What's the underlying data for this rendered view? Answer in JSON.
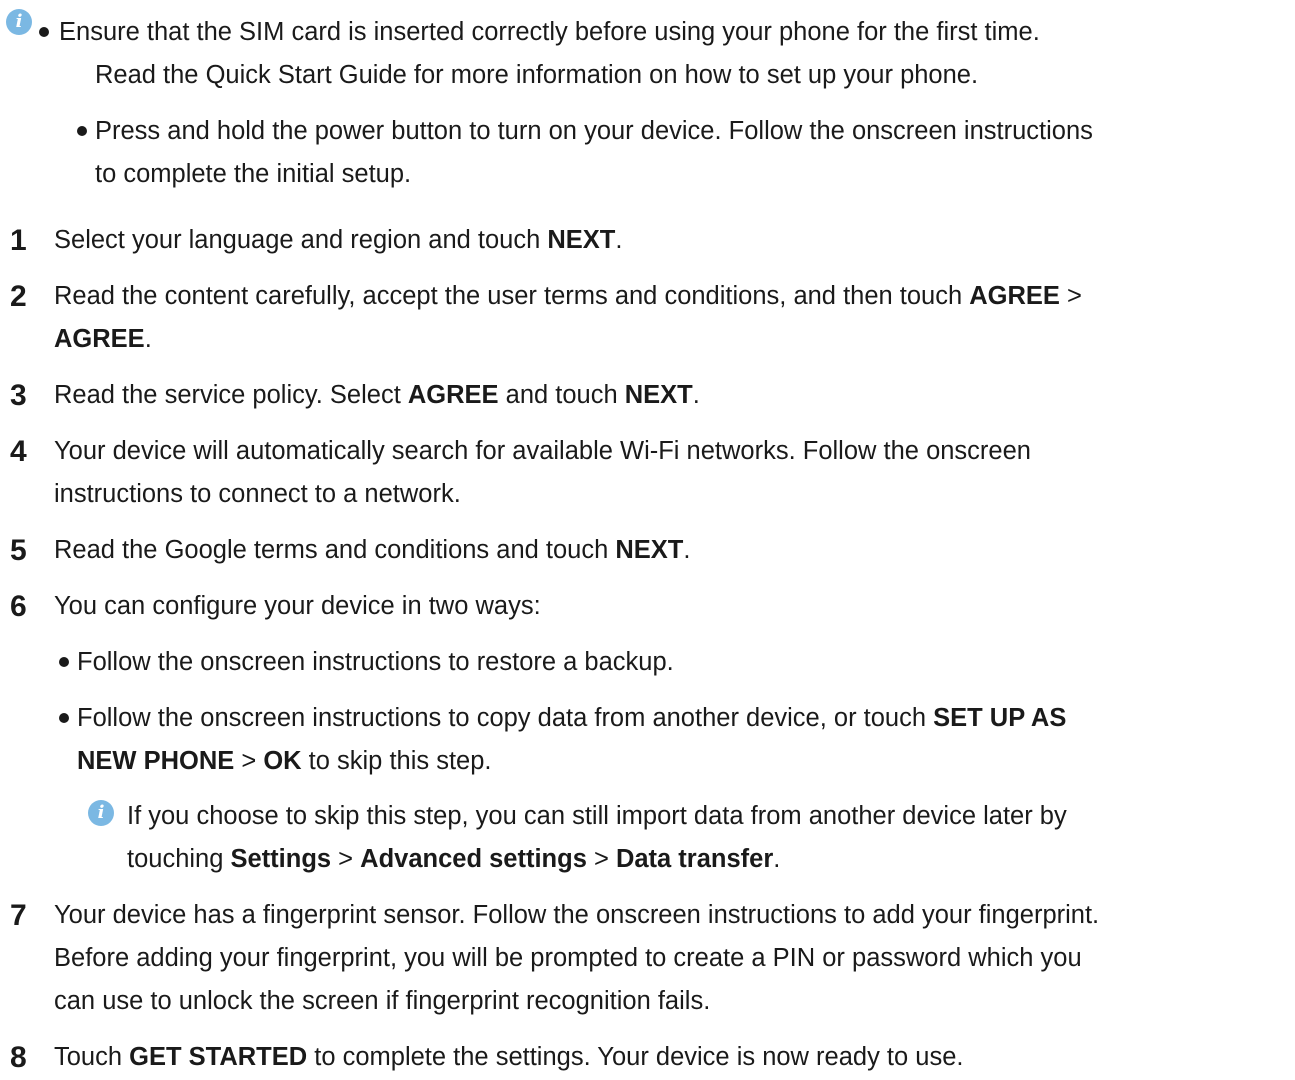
{
  "top_notes": {
    "icon": "info-icon",
    "bullet1": {
      "line1": "Ensure that the SIM card is inserted correctly before using your phone for the first time.",
      "line2": "Read the Quick Start Guide for more information on how to set up your phone."
    },
    "bullet2": {
      "line1": "Press and hold the power button to turn on your device. Follow the onscreen instructions",
      "line2": "to complete the initial setup."
    }
  },
  "steps": [
    {
      "number": "1",
      "lines": [
        {
          "t1": "Select your language and region and touch ",
          "b1": "NEXT",
          "t2": "."
        }
      ]
    },
    {
      "number": "2",
      "lines": [
        {
          "t1": "Read the content carefully, accept the user terms and conditions, and then touch ",
          "b1": "AGREE",
          "t2": " >"
        },
        {
          "b1": "AGREE",
          "t2": "."
        }
      ]
    },
    {
      "number": "3",
      "lines": [
        {
          "t1": "Read the service policy. Select ",
          "b1": "AGREE",
          "t2": " and touch ",
          "b2": "NEXT",
          "t3": "."
        }
      ]
    },
    {
      "number": "4",
      "lines": [
        {
          "t1": "Your device will automatically search for available Wi-Fi networks. Follow the onscreen"
        },
        {
          "t1": "instructions to connect to a network."
        }
      ]
    },
    {
      "number": "5",
      "lines": [
        {
          "t1": "Read the Google terms and conditions and touch ",
          "b1": "NEXT",
          "t2": "."
        }
      ]
    },
    {
      "number": "6",
      "lines": [
        {
          "t1": "You can configure your device in two ways:"
        }
      ],
      "sub_bullets": [
        {
          "line1": "Follow the onscreen instructions to restore a backup."
        },
        {
          "line1_t1": "Follow the onscreen instructions to copy data from another device, or touch ",
          "line1_b1": "SET UP AS",
          "line2_b1": "NEW PHONE",
          "line2_t1": " > ",
          "line2_b2": "OK",
          "line2_t2": " to skip this step."
        }
      ],
      "note": {
        "icon": "info-icon",
        "line1": "If you choose to skip this step, you can still import data from another device later by",
        "line2_t1": "touching ",
        "line2_b1": "Settings",
        "line2_t2": " > ",
        "line2_b2": "Advanced settings",
        "line2_t3": " > ",
        "line2_b3": "Data transfer",
        "line2_t4": "."
      }
    },
    {
      "number": "7",
      "lines": [
        {
          "t1": "Your device has a fingerprint sensor. Follow the onscreen instructions to add your fingerprint."
        },
        {
          "t1": "Before adding your fingerprint, you will be prompted to create a PIN or password which you"
        },
        {
          "t1": "can use to unlock the screen if fingerprint recognition fails."
        }
      ]
    },
    {
      "number": "8",
      "lines": [
        {
          "t1": "Touch ",
          "b1": "GET STARTED",
          "t2": " to complete the settings. Your device is now ready to use."
        }
      ]
    }
  ],
  "colors": {
    "text": "#1a1a1a",
    "info_icon": "#7bb8e3"
  }
}
